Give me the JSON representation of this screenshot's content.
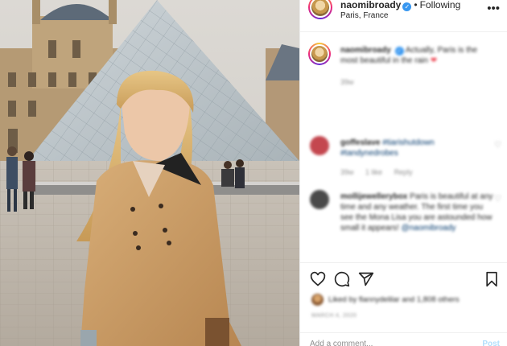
{
  "post": {
    "username": "naomibroady",
    "verified_icon": "verified-badge-icon",
    "separator": "•",
    "follow_status": "Following",
    "location": "Paris, France",
    "more_icon": "more-options-icon"
  },
  "caption": {
    "username": "naomibroady",
    "text": "Actually, Paris is the most beautiful in the rain",
    "emoji": "❤",
    "time": "39w"
  },
  "comments": [
    {
      "username": "goffeslave",
      "tags": "#tiarishutdown #tandynedrobes",
      "time": "39w",
      "likes": "1 like",
      "reply": "Reply",
      "avatar_color": "#c4474f"
    },
    {
      "username": "mollijewellerybox",
      "text": "Paris is beautiful at any time and any weather. The first time you see the Mona Lisa you are astounded how small it appears!",
      "mention": "@naomibroady",
      "avatar_color": "#4a4a4a"
    }
  ],
  "actions": {
    "icons": [
      "heart-icon",
      "comment-icon",
      "share-icon",
      "bookmark-icon"
    ]
  },
  "likes": {
    "text": "Liked by flannydelilar and 1,808 others"
  },
  "date": "MARCH 4, 2020",
  "add_comment": {
    "placeholder": "Add a comment...",
    "post_label": "Post"
  },
  "colors": {
    "link": "#00376b",
    "verified": "#3897f0",
    "post_button_disabled": "#b2dffc",
    "meta_gray": "#8e8e8e"
  }
}
